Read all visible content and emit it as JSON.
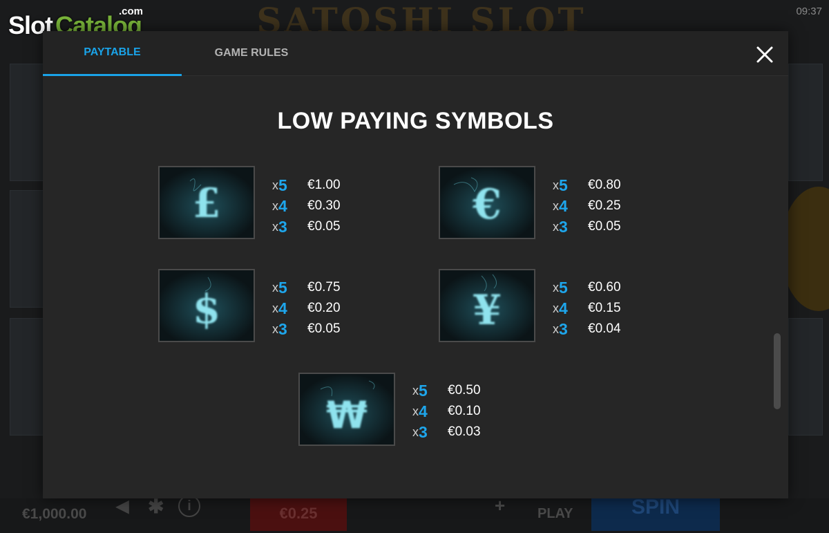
{
  "background": {
    "game_title": "SATOSHI SLOT",
    "clock": "09:37",
    "balance": "€1,000.00",
    "bet": "€0.25",
    "plus": "+",
    "autoplay": "PLAY",
    "spin": "SPIN"
  },
  "logo": {
    "slot": "Slot",
    "catalog": "Catalog",
    "com": ".com"
  },
  "tabs": [
    {
      "label": "PAYTABLE",
      "active": true
    },
    {
      "label": "GAME RULES",
      "active": false
    }
  ],
  "section_title": "LOW PAYING SYMBOLS",
  "colors": {
    "accent": "#1aa3e8",
    "modal_bg": "#262626",
    "symbol_glow": "#8fe3ee"
  },
  "symbols": [
    {
      "name": "pound",
      "glyph": "£",
      "pays": [
        {
          "x": "x",
          "count": "5",
          "amount": "€1.00"
        },
        {
          "x": "x",
          "count": "4",
          "amount": "€0.30"
        },
        {
          "x": "x",
          "count": "3",
          "amount": "€0.05"
        }
      ]
    },
    {
      "name": "euro",
      "glyph": "€",
      "pays": [
        {
          "x": "x",
          "count": "5",
          "amount": "€0.80"
        },
        {
          "x": "x",
          "count": "4",
          "amount": "€0.25"
        },
        {
          "x": "x",
          "count": "3",
          "amount": "€0.05"
        }
      ]
    },
    {
      "name": "dollar",
      "glyph": "$",
      "pays": [
        {
          "x": "x",
          "count": "5",
          "amount": "€0.75"
        },
        {
          "x": "x",
          "count": "4",
          "amount": "€0.20"
        },
        {
          "x": "x",
          "count": "3",
          "amount": "€0.05"
        }
      ]
    },
    {
      "name": "yen",
      "glyph": "¥",
      "pays": [
        {
          "x": "x",
          "count": "5",
          "amount": "€0.60"
        },
        {
          "x": "x",
          "count": "4",
          "amount": "€0.15"
        },
        {
          "x": "x",
          "count": "3",
          "amount": "€0.04"
        }
      ]
    },
    {
      "name": "won",
      "glyph": "₩",
      "pays": [
        {
          "x": "x",
          "count": "5",
          "amount": "€0.50"
        },
        {
          "x": "x",
          "count": "4",
          "amount": "€0.10"
        },
        {
          "x": "x",
          "count": "3",
          "amount": "€0.03"
        }
      ]
    }
  ]
}
